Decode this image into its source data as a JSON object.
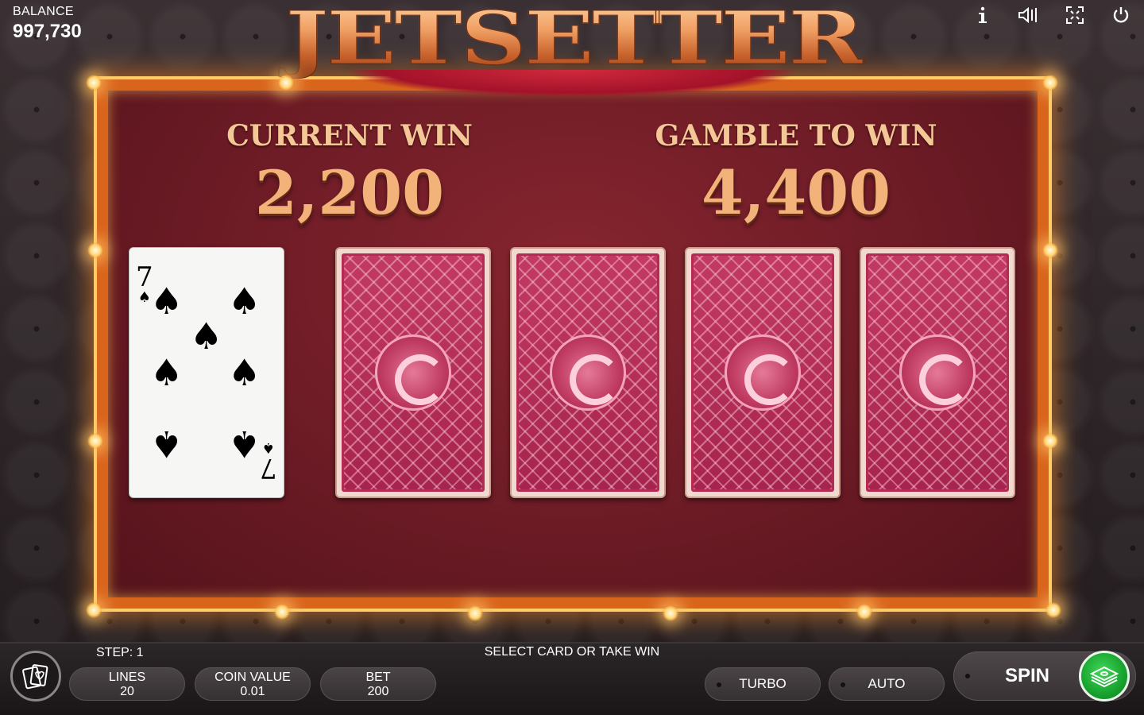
{
  "game": {
    "logo_text": "JETSETTER"
  },
  "balance": {
    "label": "BALANCE",
    "value": "997,730"
  },
  "top_icons": [
    "info-icon",
    "sound-icon",
    "fullscreen-icon",
    "power-icon"
  ],
  "gamble": {
    "current_win_label": "CURRENT WIN",
    "current_win_value": "2,200",
    "gamble_to_win_label": "GAMBLE TO WIN",
    "gamble_to_win_value": "4,400",
    "dealer_card": {
      "rank": "7",
      "suit": "♠"
    },
    "hidden_cards": 4
  },
  "status": {
    "step_text": "STEP: 1",
    "message": "SELECT CARD OR TAKE WIN"
  },
  "controls": {
    "lines_label": "LINES",
    "lines_value": "20",
    "coin_label": "COIN VALUE",
    "coin_value": "0.01",
    "bet_label": "BET",
    "bet_value": "200",
    "turbo_label": "TURBO",
    "auto_label": "AUTO",
    "spin_label": "SPIN"
  },
  "colors": {
    "frame": "#d9651c",
    "felt": "#6c1b25",
    "take_win_green": "#18a22e",
    "gold_text": "#f3c796"
  }
}
